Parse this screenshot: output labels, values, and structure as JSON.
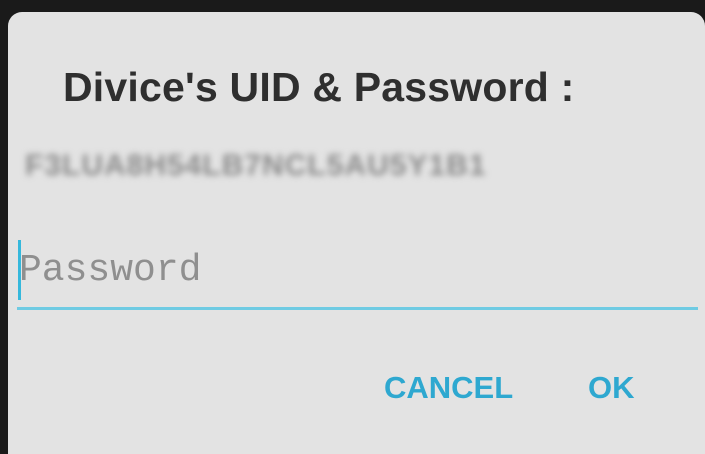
{
  "dialog": {
    "title": "Divice's UID & Password :",
    "uid_value": "F3LUA8H54LB7NCL5AU5Y1B1",
    "password_placeholder": "Password",
    "password_value": "",
    "cancel_label": "CANCEL",
    "ok_label": "OK"
  },
  "colors": {
    "accent": "#2ea8d0",
    "dialog_bg": "#e3e3e3",
    "title_text": "#2f2f2f",
    "placeholder": "#8f8f8f"
  }
}
